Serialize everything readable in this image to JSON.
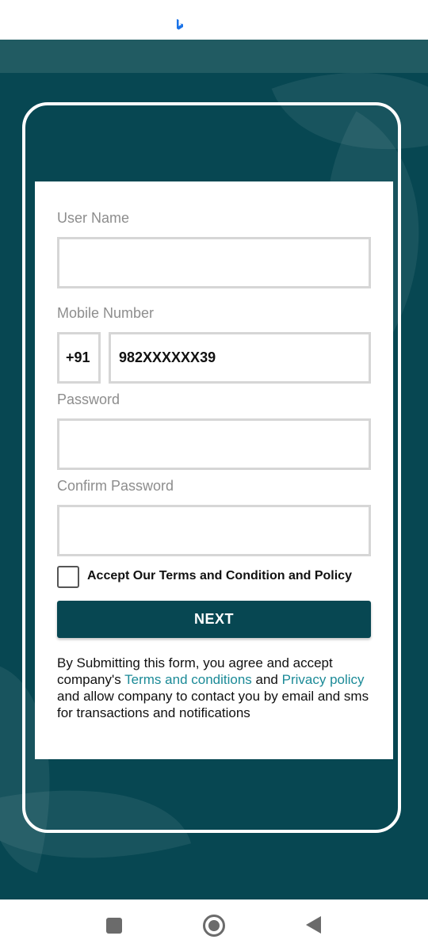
{
  "status_bar": {
    "icon": "bing-b-icon"
  },
  "form": {
    "user_name_label": "User Name",
    "user_name_value": "",
    "mobile_label": "Mobile Number",
    "country_code": "+91",
    "mobile_value": "982XXXXXX39",
    "password_label": "Password",
    "password_value": "",
    "confirm_password_label": "Confirm Password",
    "confirm_password_value": "",
    "terms_checkbox_label": "Accept Our Terms and Condition and Policy",
    "terms_checked": false,
    "next_label": "NEXT"
  },
  "disclaimer": {
    "text_1": "By Submitting this form, you agree and accept company's ",
    "terms_link": "Terms and conditions",
    "text_2": " and ",
    "privacy_link": "Privacy policy",
    "text_3": " and allow company to contact you by email and sms for transactions and notifications"
  },
  "colors": {
    "primary": "#074752",
    "link": "#1b8a97",
    "field_border": "#d6d6d6"
  },
  "nav_bar": {
    "recent_icon": "square-icon",
    "home_icon": "home-circle-icon",
    "back_icon": "back-triangle-icon"
  }
}
